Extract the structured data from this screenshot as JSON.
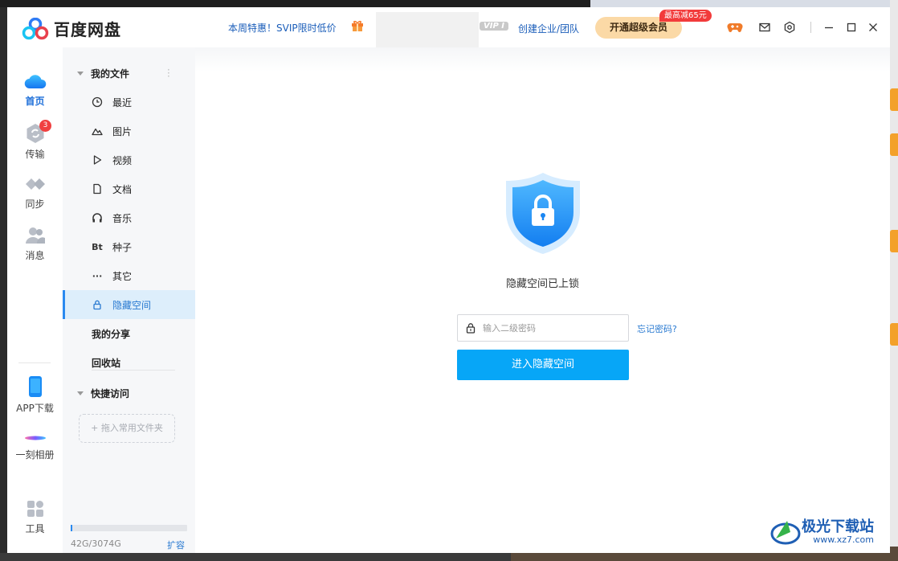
{
  "window": {
    "app_name": "百度网盘",
    "promo_text": "本周特惠！SVIP限时低价",
    "vip_tag": "VIP I",
    "enterprise_link": "创建企业/团队",
    "svip_button": "开通超级会员",
    "discount_badge": "最高减65元"
  },
  "rail": {
    "items": [
      {
        "label": "首页",
        "icon": "cloud-icon",
        "active": true
      },
      {
        "label": "传输",
        "icon": "transfer-icon",
        "badge": "3"
      },
      {
        "label": "同步",
        "icon": "sync-icon"
      },
      {
        "label": "消息",
        "icon": "contacts-icon"
      },
      {
        "label": "APP下载",
        "icon": "phone-icon"
      },
      {
        "label": "一刻相册",
        "icon": "album-icon"
      },
      {
        "label": "工具",
        "icon": "apps-grid-icon"
      }
    ]
  },
  "sidebar": {
    "my_files": "我的文件",
    "items": [
      {
        "label": "最近",
        "icon": "clock-icon"
      },
      {
        "label": "图片",
        "icon": "mountain-icon"
      },
      {
        "label": "视频",
        "icon": "play-icon"
      },
      {
        "label": "文档",
        "icon": "document-icon"
      },
      {
        "label": "音乐",
        "icon": "headphones-icon"
      },
      {
        "label": "种子",
        "icon": "bt-icon",
        "glyph": "Bt"
      },
      {
        "label": "其它",
        "icon": "more-icon",
        "glyph": "···"
      },
      {
        "label": "隐藏空间",
        "icon": "lock-icon",
        "active": true
      }
    ],
    "my_share": "我的分享",
    "recycle_bin": "回收站",
    "quick_access": "快捷访问",
    "drop_hint": "+ 拖入常用文件夹",
    "quota": "42G/3074G",
    "quota_used_fraction": 0.014,
    "expand": "扩容"
  },
  "main": {
    "locked_message": "隐藏空间已上锁",
    "password_placeholder": "输入二级密码",
    "forgot_password": "忘记密码?",
    "enter_button": "进入隐藏空间"
  },
  "watermark": {
    "name": "极光下载站",
    "url": "www.xz7.com"
  },
  "colors": {
    "accent": "#07a6f7",
    "link": "#2a7ad1",
    "svip": "#fbd9a6",
    "badge": "#f04040"
  }
}
